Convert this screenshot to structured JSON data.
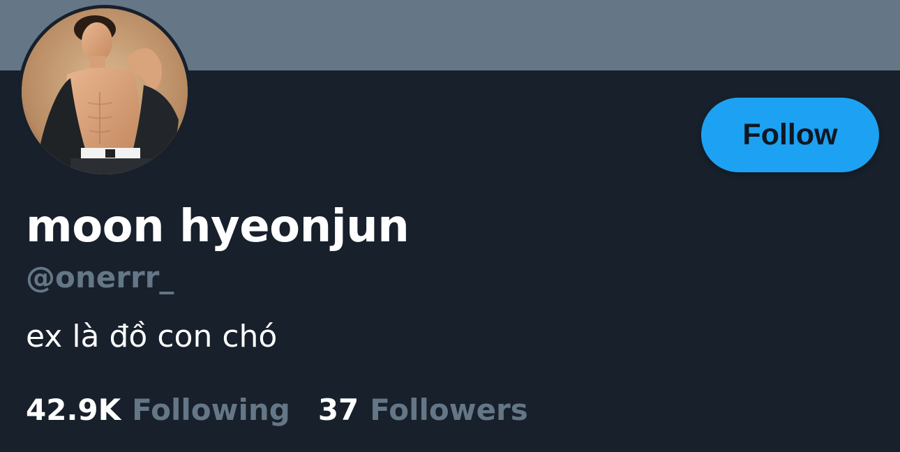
{
  "profile": {
    "display_name": "moon hyeonjun",
    "handle": "@onerrr_",
    "bio": "ex là đồ con chó",
    "follow_label": "Follow",
    "following_count": "42.9K",
    "following_label": "Following",
    "followers_count": "37",
    "followers_label": "Followers"
  },
  "colors": {
    "background": "#17202b",
    "banner": "#657786",
    "accent": "#1da1f2",
    "muted_text": "#657786",
    "primary_text": "#ffffff"
  }
}
